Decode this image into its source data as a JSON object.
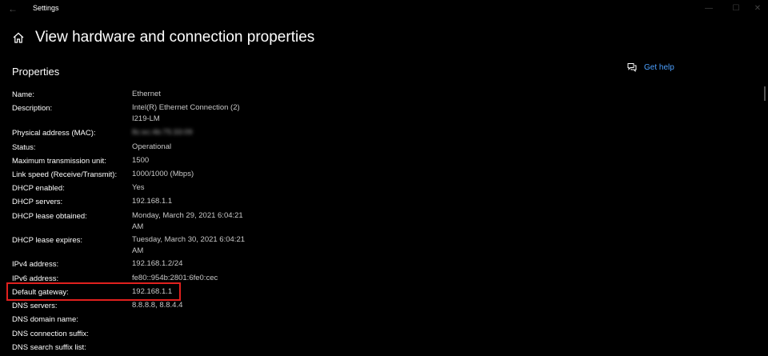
{
  "window": {
    "title": "Settings"
  },
  "page": {
    "title": "View hardware and connection properties",
    "section": "Properties"
  },
  "help": {
    "label": "Get help"
  },
  "properties": {
    "name": {
      "label": "Name:",
      "value": "Ethernet"
    },
    "description": {
      "label": "Description:",
      "value_line1": "Intel(R) Ethernet Connection (2)",
      "value_line2": "I219-LM"
    },
    "mac": {
      "label": "Physical address (MAC):",
      "value": "8c:ec:4b:75:33:09"
    },
    "status": {
      "label": "Status:",
      "value": "Operational"
    },
    "mtu": {
      "label": "Maximum transmission unit:",
      "value": "1500"
    },
    "link_speed": {
      "label": "Link speed (Receive/Transmit):",
      "value": "1000/1000 (Mbps)"
    },
    "dhcp_enabled": {
      "label": "DHCP enabled:",
      "value": "Yes"
    },
    "dhcp_servers": {
      "label": "DHCP servers:",
      "value": "192.168.1.1"
    },
    "lease_obtained": {
      "label": "DHCP lease obtained:",
      "value_line1": "Monday, March 29, 2021 6:04:21",
      "value_line2": "AM"
    },
    "lease_expires": {
      "label": "DHCP lease expires:",
      "value_line1": "Tuesday, March 30, 2021 6:04:21",
      "value_line2": "AM"
    },
    "ipv4": {
      "label": "IPv4 address:",
      "value": "192.168.1.2/24"
    },
    "ipv6": {
      "label": "IPv6 address:",
      "value": "fe80::954b:2801:6fe0:cec"
    },
    "gateway": {
      "label": "Default gateway:",
      "value": "192.168.1.1"
    },
    "dns_servers": {
      "label": "DNS servers:",
      "value": "8.8.8.8, 8.8.4.4"
    },
    "dns_domain": {
      "label": "DNS domain name:",
      "value": ""
    },
    "dns_suffix": {
      "label": "DNS connection suffix:",
      "value": ""
    },
    "dns_search": {
      "label": "DNS search suffix list:",
      "value": ""
    }
  },
  "colors": {
    "background": "#000000",
    "link": "#4ca0ff",
    "highlight_box": "#e0201e"
  }
}
